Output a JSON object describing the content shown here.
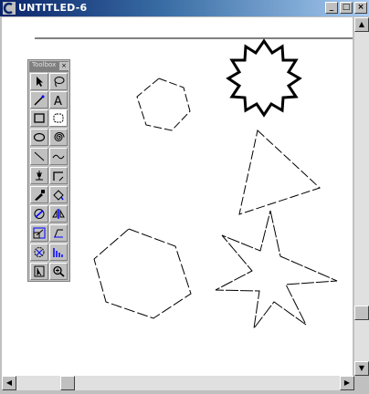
{
  "window": {
    "title": "UNTITLED-6"
  },
  "titlebar_buttons": {
    "minimize": "_",
    "maximize": "□",
    "close": "×"
  },
  "toolbox": {
    "title": "Toolbox",
    "close": "×",
    "tools": [
      {
        "name": "pointer-tool-icon"
      },
      {
        "name": "lasso-tool-icon"
      },
      {
        "name": "pen-tool-icon"
      },
      {
        "name": "text-tool-icon",
        "label": "A"
      },
      {
        "name": "rectangle-tool-icon"
      },
      {
        "name": "rounded-rectangle-tool-icon"
      },
      {
        "name": "ellipse-tool-icon"
      },
      {
        "name": "spiral-tool-icon"
      },
      {
        "name": "line-tool-icon"
      },
      {
        "name": "freehand-tool-icon"
      },
      {
        "name": "bezier-tool-icon"
      },
      {
        "name": "corner-tool-icon"
      },
      {
        "name": "eyedropper-tool-icon"
      },
      {
        "name": "paint-bucket-tool-icon"
      },
      {
        "name": "rotate-tool-icon"
      },
      {
        "name": "reflect-tool-icon"
      },
      {
        "name": "scale-tool-icon"
      },
      {
        "name": "skew-tool-icon"
      },
      {
        "name": "trace-tool-icon"
      },
      {
        "name": "blend-tool-icon"
      },
      {
        "name": "page-tool-icon"
      },
      {
        "name": "zoom-tool-icon"
      }
    ]
  },
  "colors": {
    "titlebar_start": "#0a246a",
    "titlebar_end": "#a6caf0",
    "canvas": "#ffffff"
  }
}
